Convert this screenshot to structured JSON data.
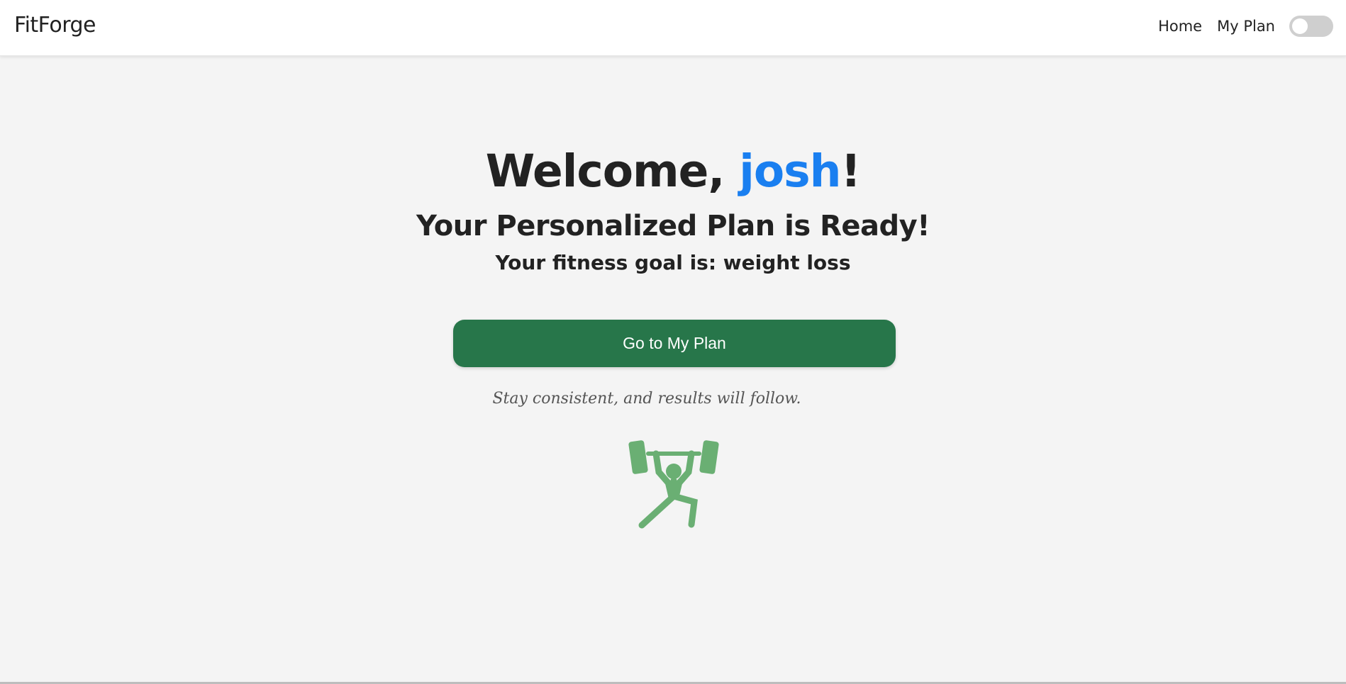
{
  "brand": "FitForge",
  "nav": {
    "home_label": "Home",
    "my_plan_label": "My Plan",
    "theme_toggle": "off"
  },
  "welcome": {
    "prefix": "Welcome, ",
    "username": "josh",
    "suffix": "!"
  },
  "subtitle": "Your Personalized Plan is Ready!",
  "goal_text": "Your fitness goal is: weight loss",
  "cta_label": "Go to My Plan",
  "quote": "Stay consistent, and results will follow.",
  "illustration": "weightlifter-icon",
  "colors": {
    "accent_blue": "#1a7ff0",
    "button_green": "#27764a",
    "icon_green": "#6aaf73",
    "background": "#f4f4f4"
  }
}
